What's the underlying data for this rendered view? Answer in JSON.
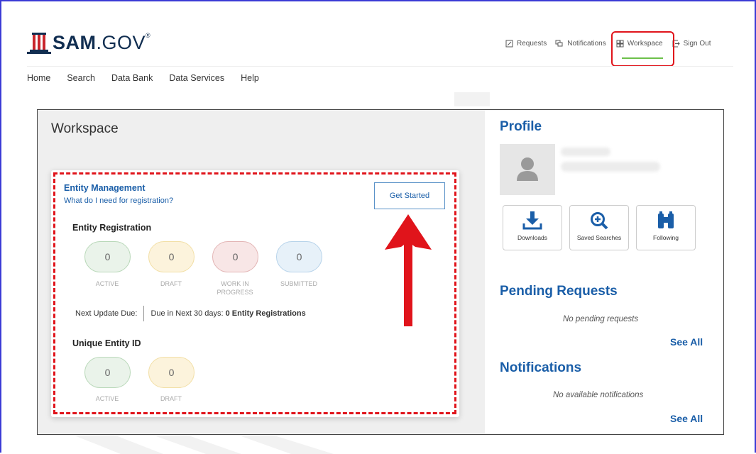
{
  "header": {
    "brand_bold": "SAM",
    "brand_rest": ".GOV",
    "brand_mark": "®",
    "top_nav": [
      {
        "label": "Requests",
        "icon": "edit-icon"
      },
      {
        "label": "Notifications",
        "icon": "chat-icon"
      },
      {
        "label": "Workspace",
        "icon": "grid-icon"
      },
      {
        "label": "Sign Out",
        "icon": "sign-out-icon"
      }
    ],
    "main_nav": [
      "Home",
      "Search",
      "Data Bank",
      "Data Services",
      "Help"
    ]
  },
  "workspace": {
    "title": "Workspace",
    "entity_management": {
      "title": "Entity Management",
      "link": "What do I need for registration?",
      "get_started": "Get Started",
      "entity_registration": {
        "title": "Entity Registration",
        "stats": [
          {
            "value": "0",
            "label": "ACTIVE"
          },
          {
            "value": "0",
            "label": "DRAFT"
          },
          {
            "value": "0",
            "label": "WORK IN PROGRESS"
          },
          {
            "value": "0",
            "label": "SUBMITTED"
          }
        ],
        "next_update": "Next Update Due:",
        "due_prefix": "Due in Next 30 days:",
        "due_value": "0 Entity Registrations"
      },
      "unique_entity_id": {
        "title": "Unique Entity ID",
        "stats": [
          {
            "value": "0",
            "label": "ACTIVE"
          },
          {
            "value": "0",
            "label": "DRAFT"
          }
        ]
      }
    }
  },
  "profile": {
    "title": "Profile",
    "quick_actions": [
      {
        "label": "Downloads",
        "icon": "download-icon"
      },
      {
        "label": "Saved Searches",
        "icon": "search-plus-icon"
      },
      {
        "label": "Following",
        "icon": "binoculars-icon"
      }
    ]
  },
  "pending_requests": {
    "title": "Pending Requests",
    "empty": "No pending requests",
    "see_all": "See All"
  },
  "notifications": {
    "title": "Notifications",
    "empty": "No available notifications",
    "see_all": "See All"
  },
  "colors": {
    "accent": "#1a5ea8",
    "highlight": "#e0141b",
    "brand": "#112e51"
  }
}
